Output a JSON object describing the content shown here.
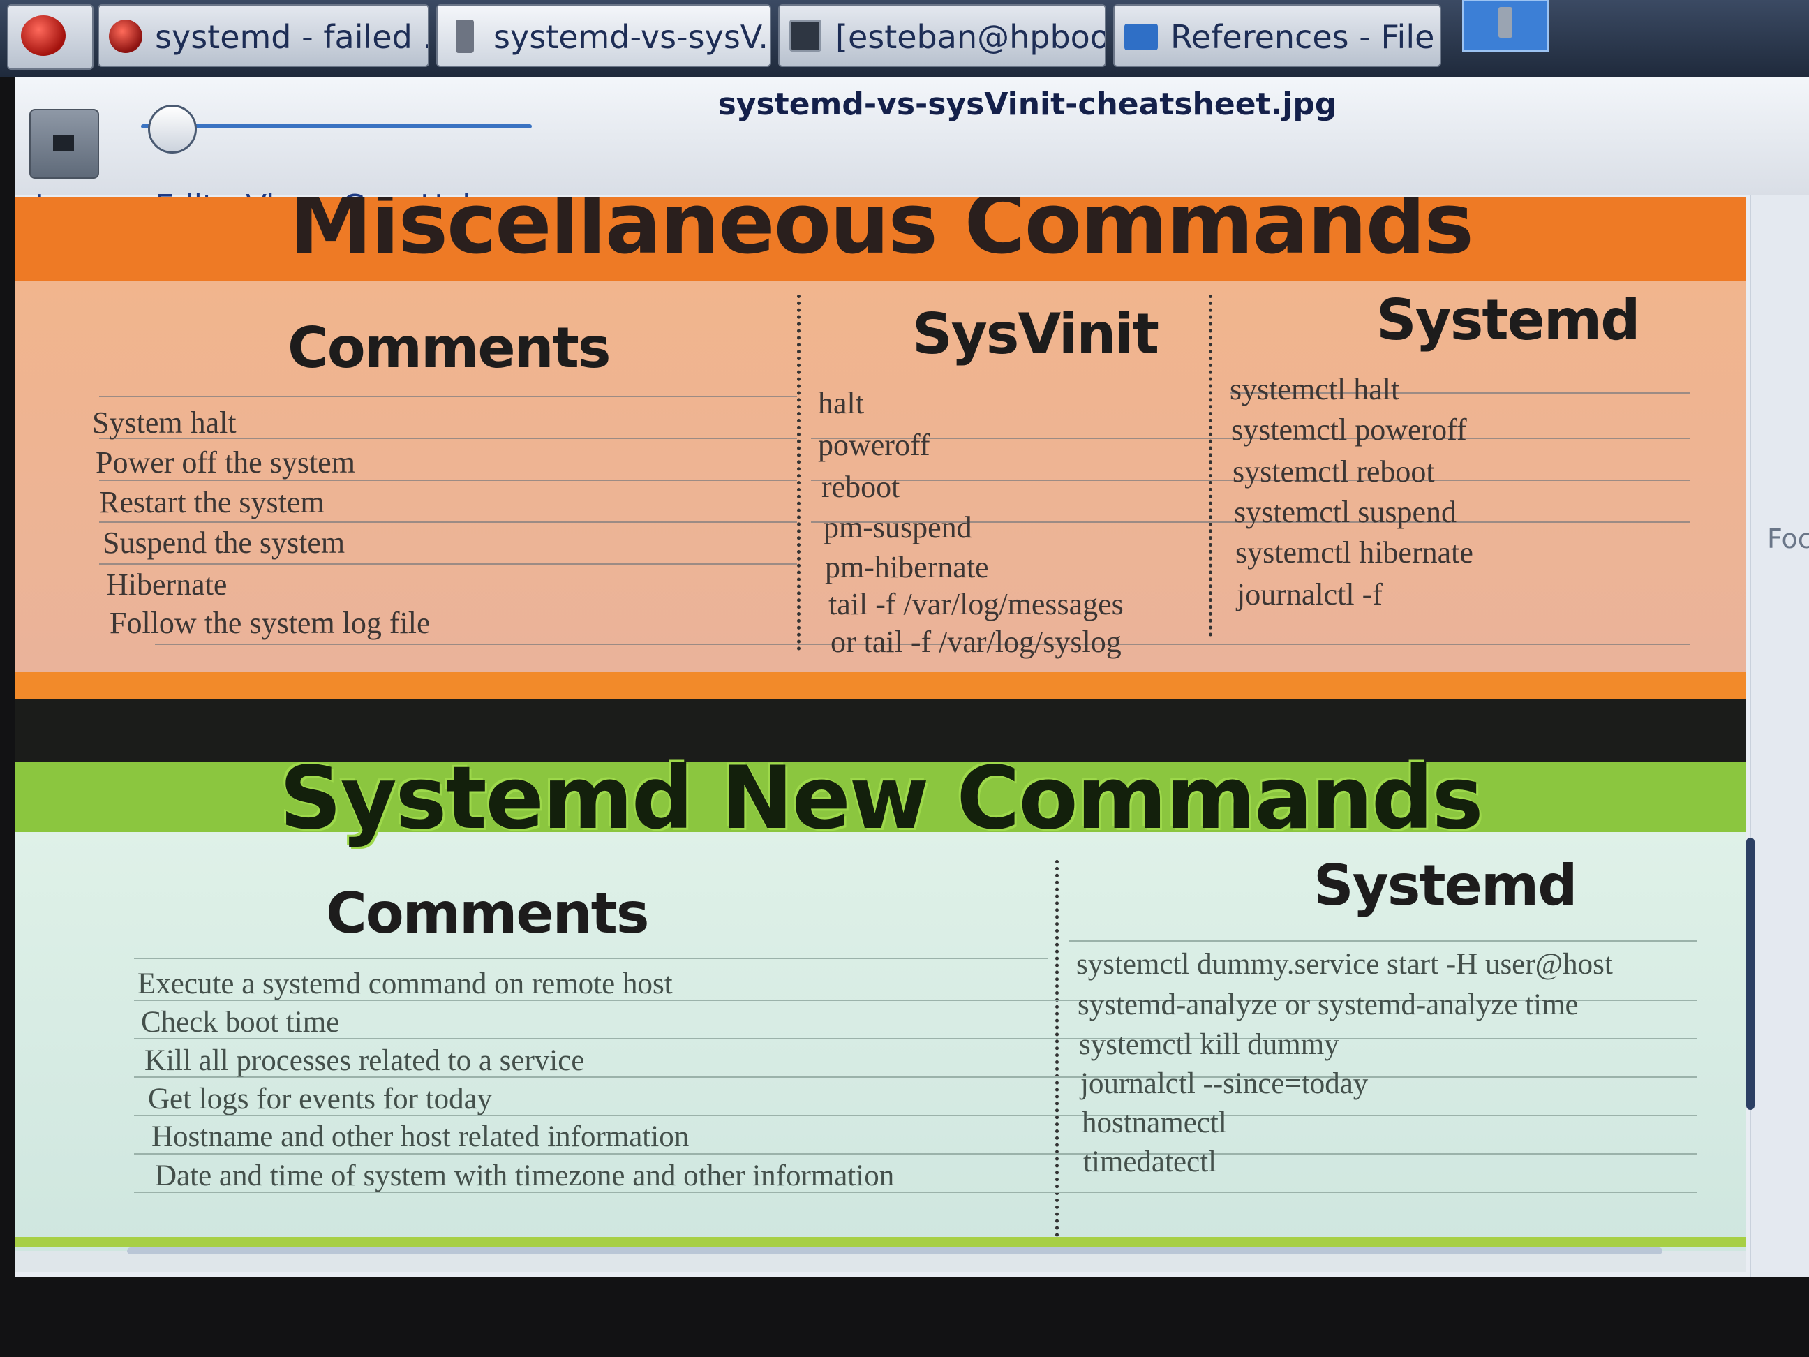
{
  "taskbar": {
    "tasks": [
      {
        "label": "systemd - failed ..."
      },
      {
        "label": "systemd-vs-sysV..."
      },
      {
        "label": "[esteban@hpboo..."
      },
      {
        "label": "References - File ..."
      }
    ]
  },
  "viewer": {
    "title": "systemd-vs-sysVinit-cheatsheet.jpg",
    "zoom_fraction": 0.08,
    "menu": [
      "Image",
      "Edit",
      "View",
      "Go",
      "Help"
    ],
    "side_label": "Foc"
  },
  "sheet": {
    "misc": {
      "title": "Miscellaneous Commands",
      "headers": [
        "Comments",
        "SysVinit",
        "Systemd"
      ],
      "rows": [
        {
          "comment": "System halt",
          "sysvinit": "halt",
          "systemd": "systemctl halt"
        },
        {
          "comment": "Power off the system",
          "sysvinit": "poweroff",
          "systemd": "systemctl poweroff"
        },
        {
          "comment": "Restart the system",
          "sysvinit": "reboot",
          "systemd": "systemctl reboot"
        },
        {
          "comment": "Suspend the system",
          "sysvinit": "pm-suspend",
          "systemd": "systemctl suspend"
        },
        {
          "comment": "Hibernate",
          "sysvinit": "pm-hibernate",
          "systemd": "systemctl hibernate"
        },
        {
          "comment": "Follow the system log file",
          "sysvinit": "tail -f /var/log/messages",
          "sysvinit2": "or tail -f /var/log/syslog",
          "systemd": "journalctl -f"
        }
      ]
    },
    "new": {
      "title": "Systemd New Commands",
      "headers": [
        "Comments",
        "Systemd"
      ],
      "rows": [
        {
          "comment": "Execute a systemd command on remote host",
          "systemd": "systemctl dummy.service start -H user@host"
        },
        {
          "comment": "Check boot time",
          "systemd": "systemd-analyze or systemd-analyze time"
        },
        {
          "comment": "Kill all processes related to a service",
          "systemd": "systemctl kill dummy"
        },
        {
          "comment": "Get logs for events for today",
          "systemd": "journalctl --since=today"
        },
        {
          "comment": "Hostname and other host related information",
          "systemd": "hostnamectl"
        },
        {
          "comment": "Date and time of system with timezone and other information",
          "systemd": "timedatectl"
        }
      ]
    }
  },
  "colors": {
    "orange": "#ee7a25",
    "salmon": "#f1b58d",
    "green": "#8bc63f",
    "mint": "#dff1e8",
    "taskbar": "#2c3a52"
  }
}
